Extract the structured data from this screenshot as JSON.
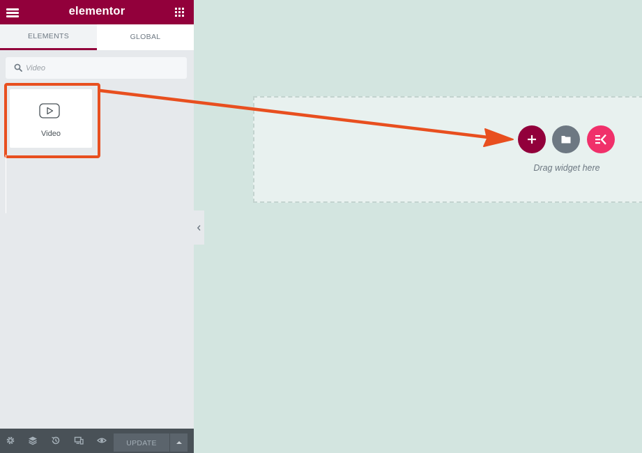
{
  "header": {
    "logo": "elementor"
  },
  "tabs": [
    {
      "label": "ELEMENTS",
      "active": true
    },
    {
      "label": "GLOBAL",
      "active": false
    }
  ],
  "search": {
    "value": "",
    "placeholder": "Video"
  },
  "widgets": [
    {
      "label": "Video",
      "icon": "video-play-icon"
    }
  ],
  "footer": {
    "update_label": "UPDATE",
    "icons": [
      "gear-icon",
      "layers-icon",
      "history-icon",
      "responsive-icon",
      "eye-icon"
    ]
  },
  "canvas": {
    "drop_text": "Drag widget here"
  },
  "colors": {
    "brand": "#92003b",
    "highlight": "#e84f1f",
    "template_btn": "#6d7882",
    "ek_btn": "#f0306a",
    "canvas_bg": "#d3e5e0"
  }
}
